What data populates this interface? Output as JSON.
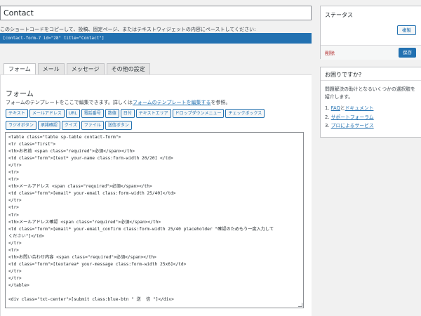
{
  "form_title": "Contact",
  "shortcode_hint": "このショートコードをコピーして、投稿、固定ページ、またはテキストウィジェットの内容にペーストしてください:",
  "shortcode": "[contact-form-7 id=\"28\" title=\"Contact\"]",
  "tabs": [
    {
      "label": "フォーム"
    },
    {
      "label": "メール"
    },
    {
      "label": "メッセージ"
    },
    {
      "label": "その他の設定"
    }
  ],
  "panel": {
    "title": "フォーム",
    "desc_prefix": "フォームのテンプレートをここで編集できます。詳しくは",
    "desc_link": "フォームのテンプレートを編集する",
    "desc_suffix": "を参照。"
  },
  "tag_buttons": {
    "row1": [
      "テキスト",
      "メールアドレス",
      "URL",
      "電話番号",
      "数値",
      "日付",
      "テキストエリア",
      "ドロップダウンメニュー",
      "チェックボックス"
    ],
    "row2": [
      "ラジオボタン",
      "承諾確認",
      "クイズ",
      "ファイル",
      "送信ボタン"
    ]
  },
  "form_code": "<table class=\"table sp-table contact-form\">\n<tr class=\"first\">\n<th>お名前 <span class=\"required\">必須</span></th>\n<td class=\"form\">[text* your-name class:form-width 20/20] </td>\n</tr>\n<tr>\n<tr>\n<th>メールアドレス <span class=\"required\">必須</span></th>\n<td class=\"form\">[email* your-email class:form-width 25/40]</td>\n</tr>\n<tr>\n<tr>\n<th>メールアドレス確認 <span class=\"required\">必須</span></th>\n<td class=\"form\">[email* your-email_confirm class:form-width 25/40 placeholder \"確認のためもう一度入力して\nください\"]</td>\n</tr>\n<tr>\n<th>お問い合わせ内容 <span class=\"required\">必須</span></th>\n<td class=\"form\">[textarea* your-message class:form-width 25x6]</td>\n</tr>\n</tr>\n</table>\n\n<div class=\"txt-center\">[submit class:blue-btn \" 送  信 \"]</div>",
  "status": {
    "title": "ステータス",
    "duplicate_label": "複製",
    "delete_label": "削除",
    "save_label": "保存"
  },
  "help": {
    "title": "お困りですか?",
    "text": "問題解決の助けとなるいくつかの選択肢を紹介します。",
    "items": [
      {
        "link": "FAQ",
        "conj": "と",
        "link2": "ドキュメント",
        "num": "1."
      },
      {
        "link": "サポートフォーラム",
        "num": "2."
      },
      {
        "link": "プロによるサービス",
        "num": "3."
      }
    ]
  }
}
